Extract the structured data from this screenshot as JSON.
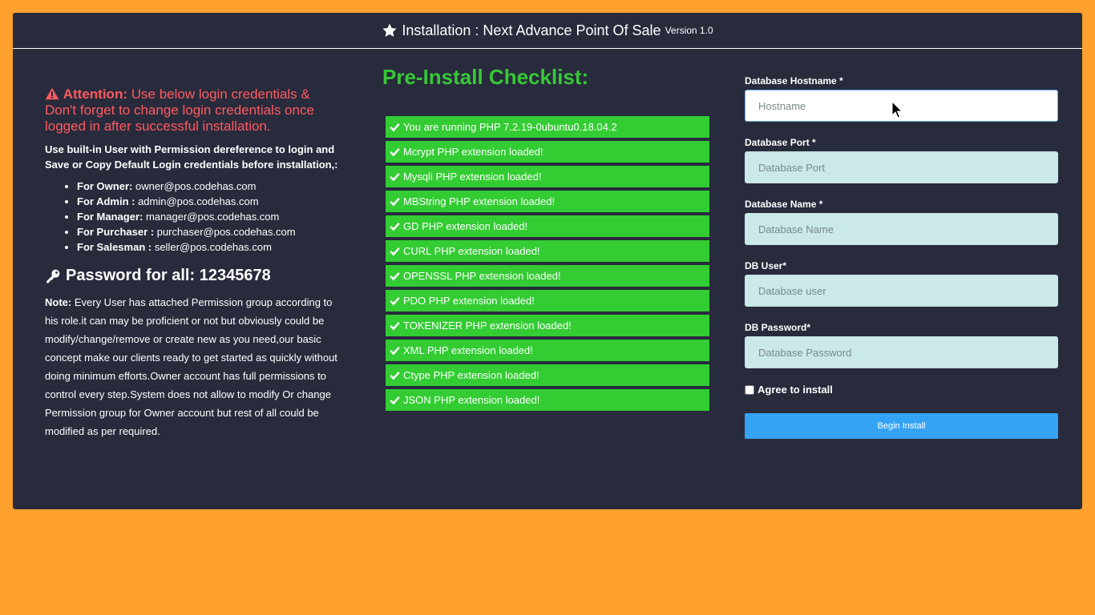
{
  "header": {
    "title": "Installation : Next Advance Point Of Sale",
    "version": "Version 1.0",
    "icon": "star-icon"
  },
  "left": {
    "attention_label": "Attention:",
    "attention_text": "Use below login credentials & Don't forget to change login credentials once logged in after successful installation.",
    "use_builtin": "Use built-in User with Permission dereference to login and Save or Copy Default Login credentials before installation,:",
    "credentials": [
      {
        "role": "For Owner:",
        "email": "owner@pos.codehas.com"
      },
      {
        "role": "For Admin :",
        "email": "admin@pos.codehas.com"
      },
      {
        "role": "For Manager:",
        "email": "manager@pos.codehas.com"
      },
      {
        "role": "For Purchaser :",
        "email": "purchaser@pos.codehas.com"
      },
      {
        "role": "For Salesman :",
        "email": "seller@pos.codehas.com"
      }
    ],
    "password_line": "Password for all: 12345678",
    "note_label": "Note:",
    "note_text": "Every User has attached Permission group according to his role.it can may be proficient or not but obviously could be modify/change/remove or create new as you need,our basic concept make our clients ready to get started as quickly without doing minimum efforts.Owner account has full permissions to control every step.System does not allow to modify Or change Permission group for Owner account but rest of all could be modified as per required."
  },
  "checklist": {
    "title": "Pre-Install Checklist:",
    "items": [
      "You are running PHP 7.2.19-0ubuntu0.18.04.2",
      "Mcrypt PHP extension loaded!",
      "Mysqli PHP extension loaded!",
      "MBString PHP extension loaded!",
      "GD PHP extension loaded!",
      "CURL PHP extension loaded!",
      "OPENSSL PHP extension loaded!",
      "PDO PHP extension loaded!",
      "TOKENIZER PHP extension loaded!",
      "XML PHP extension loaded!",
      "Ctype PHP extension loaded!",
      "JSON PHP extension loaded!"
    ]
  },
  "form": {
    "hostname": {
      "label": "Database Hostname *",
      "placeholder": "Hostname",
      "value": ""
    },
    "port": {
      "label": "Database Port *",
      "placeholder": "Database Port",
      "value": ""
    },
    "name": {
      "label": "Database Name *",
      "placeholder": "Database Name",
      "value": ""
    },
    "user": {
      "label": "DB User*",
      "placeholder": "Database user",
      "value": ""
    },
    "password": {
      "label": "DB Password*",
      "placeholder": "Database Password",
      "value": ""
    },
    "agree_label": "Agree to install",
    "agree_checked": false,
    "submit_label": "Begin Install"
  },
  "colors": {
    "page_background": "#ffa12f",
    "panel_background": "#282b3c",
    "attention": "#ff5a5f",
    "checklist_title": "#37c837",
    "check_item": "#33cc33",
    "input_background": "#cbe9e9",
    "button": "#35a3f4"
  }
}
